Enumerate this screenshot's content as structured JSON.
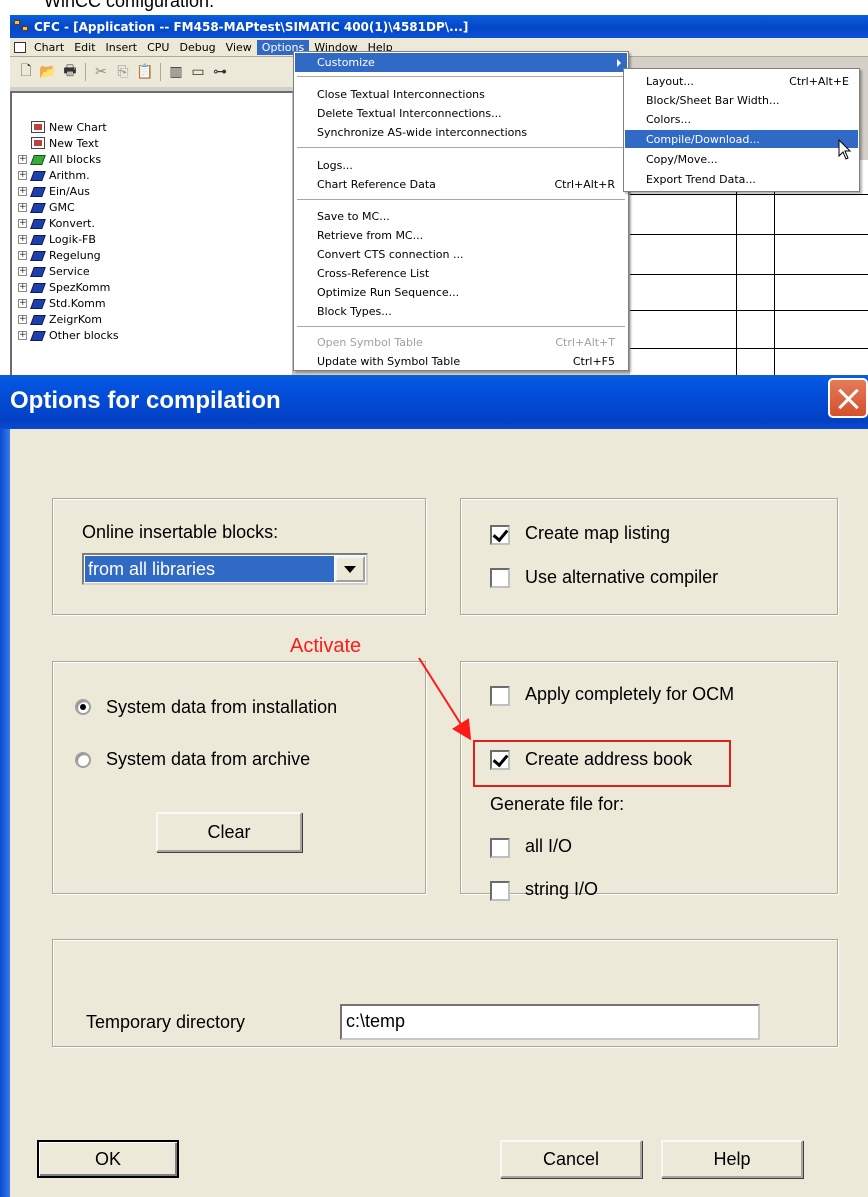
{
  "caption": "WinCC configuration.",
  "cfc": {
    "title": "CFC - [Application -- FM458-MAPtest\\SIMATIC 400(1)\\4581DP\\...]",
    "menu": [
      "Chart",
      "Edit",
      "Insert",
      "CPU",
      "Debug",
      "View",
      "Options",
      "Window",
      "Help"
    ],
    "active_menu": "Options",
    "tree": [
      {
        "label": "New Chart",
        "type": "chart"
      },
      {
        "label": "New Text",
        "type": "text"
      },
      {
        "label": "All blocks",
        "type": "lib-green"
      },
      {
        "label": "Arithm.",
        "type": "lib"
      },
      {
        "label": "Ein/Aus",
        "type": "lib"
      },
      {
        "label": "GMC",
        "type": "lib"
      },
      {
        "label": "Konvert.",
        "type": "lib"
      },
      {
        "label": "Logik-FB",
        "type": "lib"
      },
      {
        "label": "Regelung",
        "type": "lib"
      },
      {
        "label": "Service",
        "type": "lib"
      },
      {
        "label": "SpezKomm",
        "type": "lib"
      },
      {
        "label": "Std.Komm",
        "type": "lib"
      },
      {
        "label": "ZeigrKom",
        "type": "lib"
      },
      {
        "label": "Other blocks",
        "type": "lib"
      }
    ],
    "options_menu": {
      "customize": "Customize",
      "items": [
        {
          "label": "Close Textual Interconnections",
          "shortcut": ""
        },
        {
          "label": "Delete Textual Interconnections...",
          "shortcut": ""
        },
        {
          "label": "Synchronize AS-wide interconnections",
          "shortcut": ""
        },
        {
          "label": "Logs...",
          "shortcut": ""
        },
        {
          "label": "Chart Reference Data",
          "shortcut": "Ctrl+Alt+R"
        },
        {
          "label": "Save to MC...",
          "shortcut": ""
        },
        {
          "label": "Retrieve from MC...",
          "shortcut": ""
        },
        {
          "label": "Convert CTS connection ...",
          "shortcut": ""
        },
        {
          "label": "Cross-Reference List",
          "shortcut": ""
        },
        {
          "label": "Optimize Run Sequence...",
          "shortcut": ""
        },
        {
          "label": "Block Types...",
          "shortcut": ""
        },
        {
          "label": "Open Symbol Table",
          "shortcut": "Ctrl+Alt+T",
          "disabled": true
        },
        {
          "label": "Update with Symbol Table",
          "shortcut": "Ctrl+F5"
        }
      ]
    },
    "customize_menu": [
      {
        "label": "Layout...",
        "shortcut": "Ctrl+Alt+E"
      },
      {
        "label": "Block/Sheet Bar Width...",
        "shortcut": ""
      },
      {
        "label": "Colors...",
        "shortcut": ""
      },
      {
        "label": "Compile/Download...",
        "shortcut": "",
        "selected": true
      },
      {
        "label": "Copy/Move...",
        "shortcut": ""
      },
      {
        "label": "Export Trend Data...",
        "shortcut": ""
      }
    ]
  },
  "dialog": {
    "title": "Options for compilation",
    "online_blocks_label": "Online insertable blocks:",
    "online_blocks_value": "from all libraries",
    "create_map_listing": {
      "label": "Create map listing",
      "checked": true
    },
    "use_alt_compiler": {
      "label": "Use alternative compiler",
      "checked": false
    },
    "sys_from_install": {
      "label": "System data from installation",
      "selected": true
    },
    "sys_from_archive": {
      "label": "System data from archive",
      "selected": false
    },
    "clear_button": "Clear",
    "apply_ocm": {
      "label": "Apply completely for OCM",
      "checked": false
    },
    "create_address_book": {
      "label": "Create address book",
      "checked": true
    },
    "generate_file_for": "Generate file for:",
    "all_io": {
      "label": "all I/O",
      "checked": false
    },
    "string_io": {
      "label": "string I/O",
      "checked": false
    },
    "temp_dir_label": "Temporary directory",
    "temp_dir_value": "c:\\temp",
    "ok_button": "OK",
    "cancel_button": "Cancel",
    "help_button": "Help"
  },
  "annotation": {
    "text": "Activate",
    "color": "#ff1a1a"
  }
}
